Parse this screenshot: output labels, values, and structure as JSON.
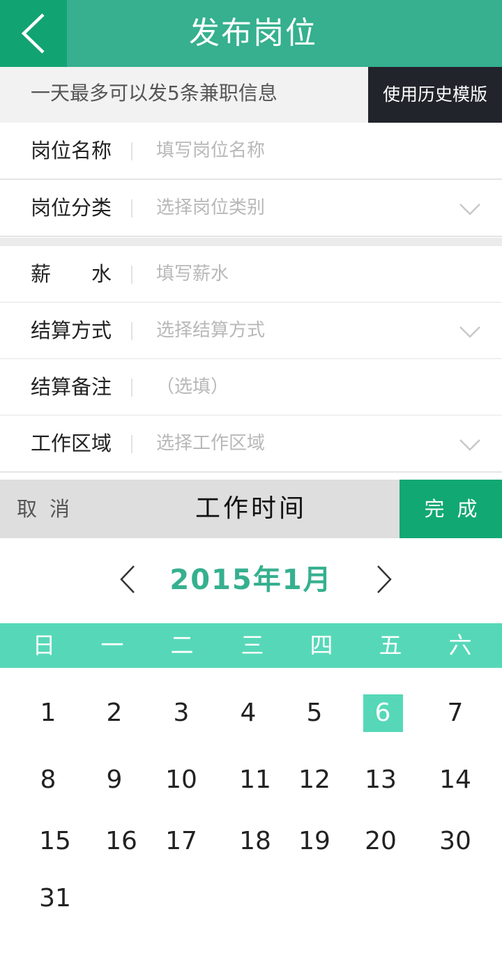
{
  "header": {
    "title": "发布岗位",
    "back_icon": "chevron-left-icon"
  },
  "notice": {
    "text": "一天最多可以发5条兼职信息",
    "history_button": "使用历史模版"
  },
  "form": {
    "rows": [
      {
        "label": "岗位名称",
        "placeholder": "填写岗位名称",
        "has_dropdown": false
      },
      {
        "label": "岗位分类",
        "placeholder": "选择岗位类别",
        "has_dropdown": true
      },
      {
        "label": "薪　　水",
        "placeholder": "填写薪水",
        "has_dropdown": false
      },
      {
        "label": "结算方式",
        "placeholder": "选择结算方式",
        "has_dropdown": true
      },
      {
        "label": "结算备注",
        "placeholder": "（选填）",
        "has_dropdown": false
      },
      {
        "label": "工作区域",
        "placeholder": "选择工作区域",
        "has_dropdown": true
      }
    ]
  },
  "picker": {
    "cancel_label": "取消",
    "title": "工作时间",
    "done_label": "完成",
    "month_label": "2015年1月",
    "weekdays": [
      "日",
      "一",
      "二",
      "三",
      "四",
      "五",
      "六"
    ],
    "days": [
      [
        "1",
        "2",
        "3",
        "4",
        "5",
        "6",
        "7"
      ],
      [
        "8",
        "9",
        "10",
        "11",
        "12",
        "13",
        "14"
      ],
      [
        "15",
        "16",
        "17",
        "18",
        "19",
        "20",
        "30"
      ],
      [
        "31"
      ]
    ],
    "selected_day": "6"
  },
  "colors": {
    "header_bg": "#36b08f",
    "back_bg": "#12a373",
    "accent": "#56d8b8",
    "done_bg": "#12a873",
    "history_bg": "#22242c"
  }
}
